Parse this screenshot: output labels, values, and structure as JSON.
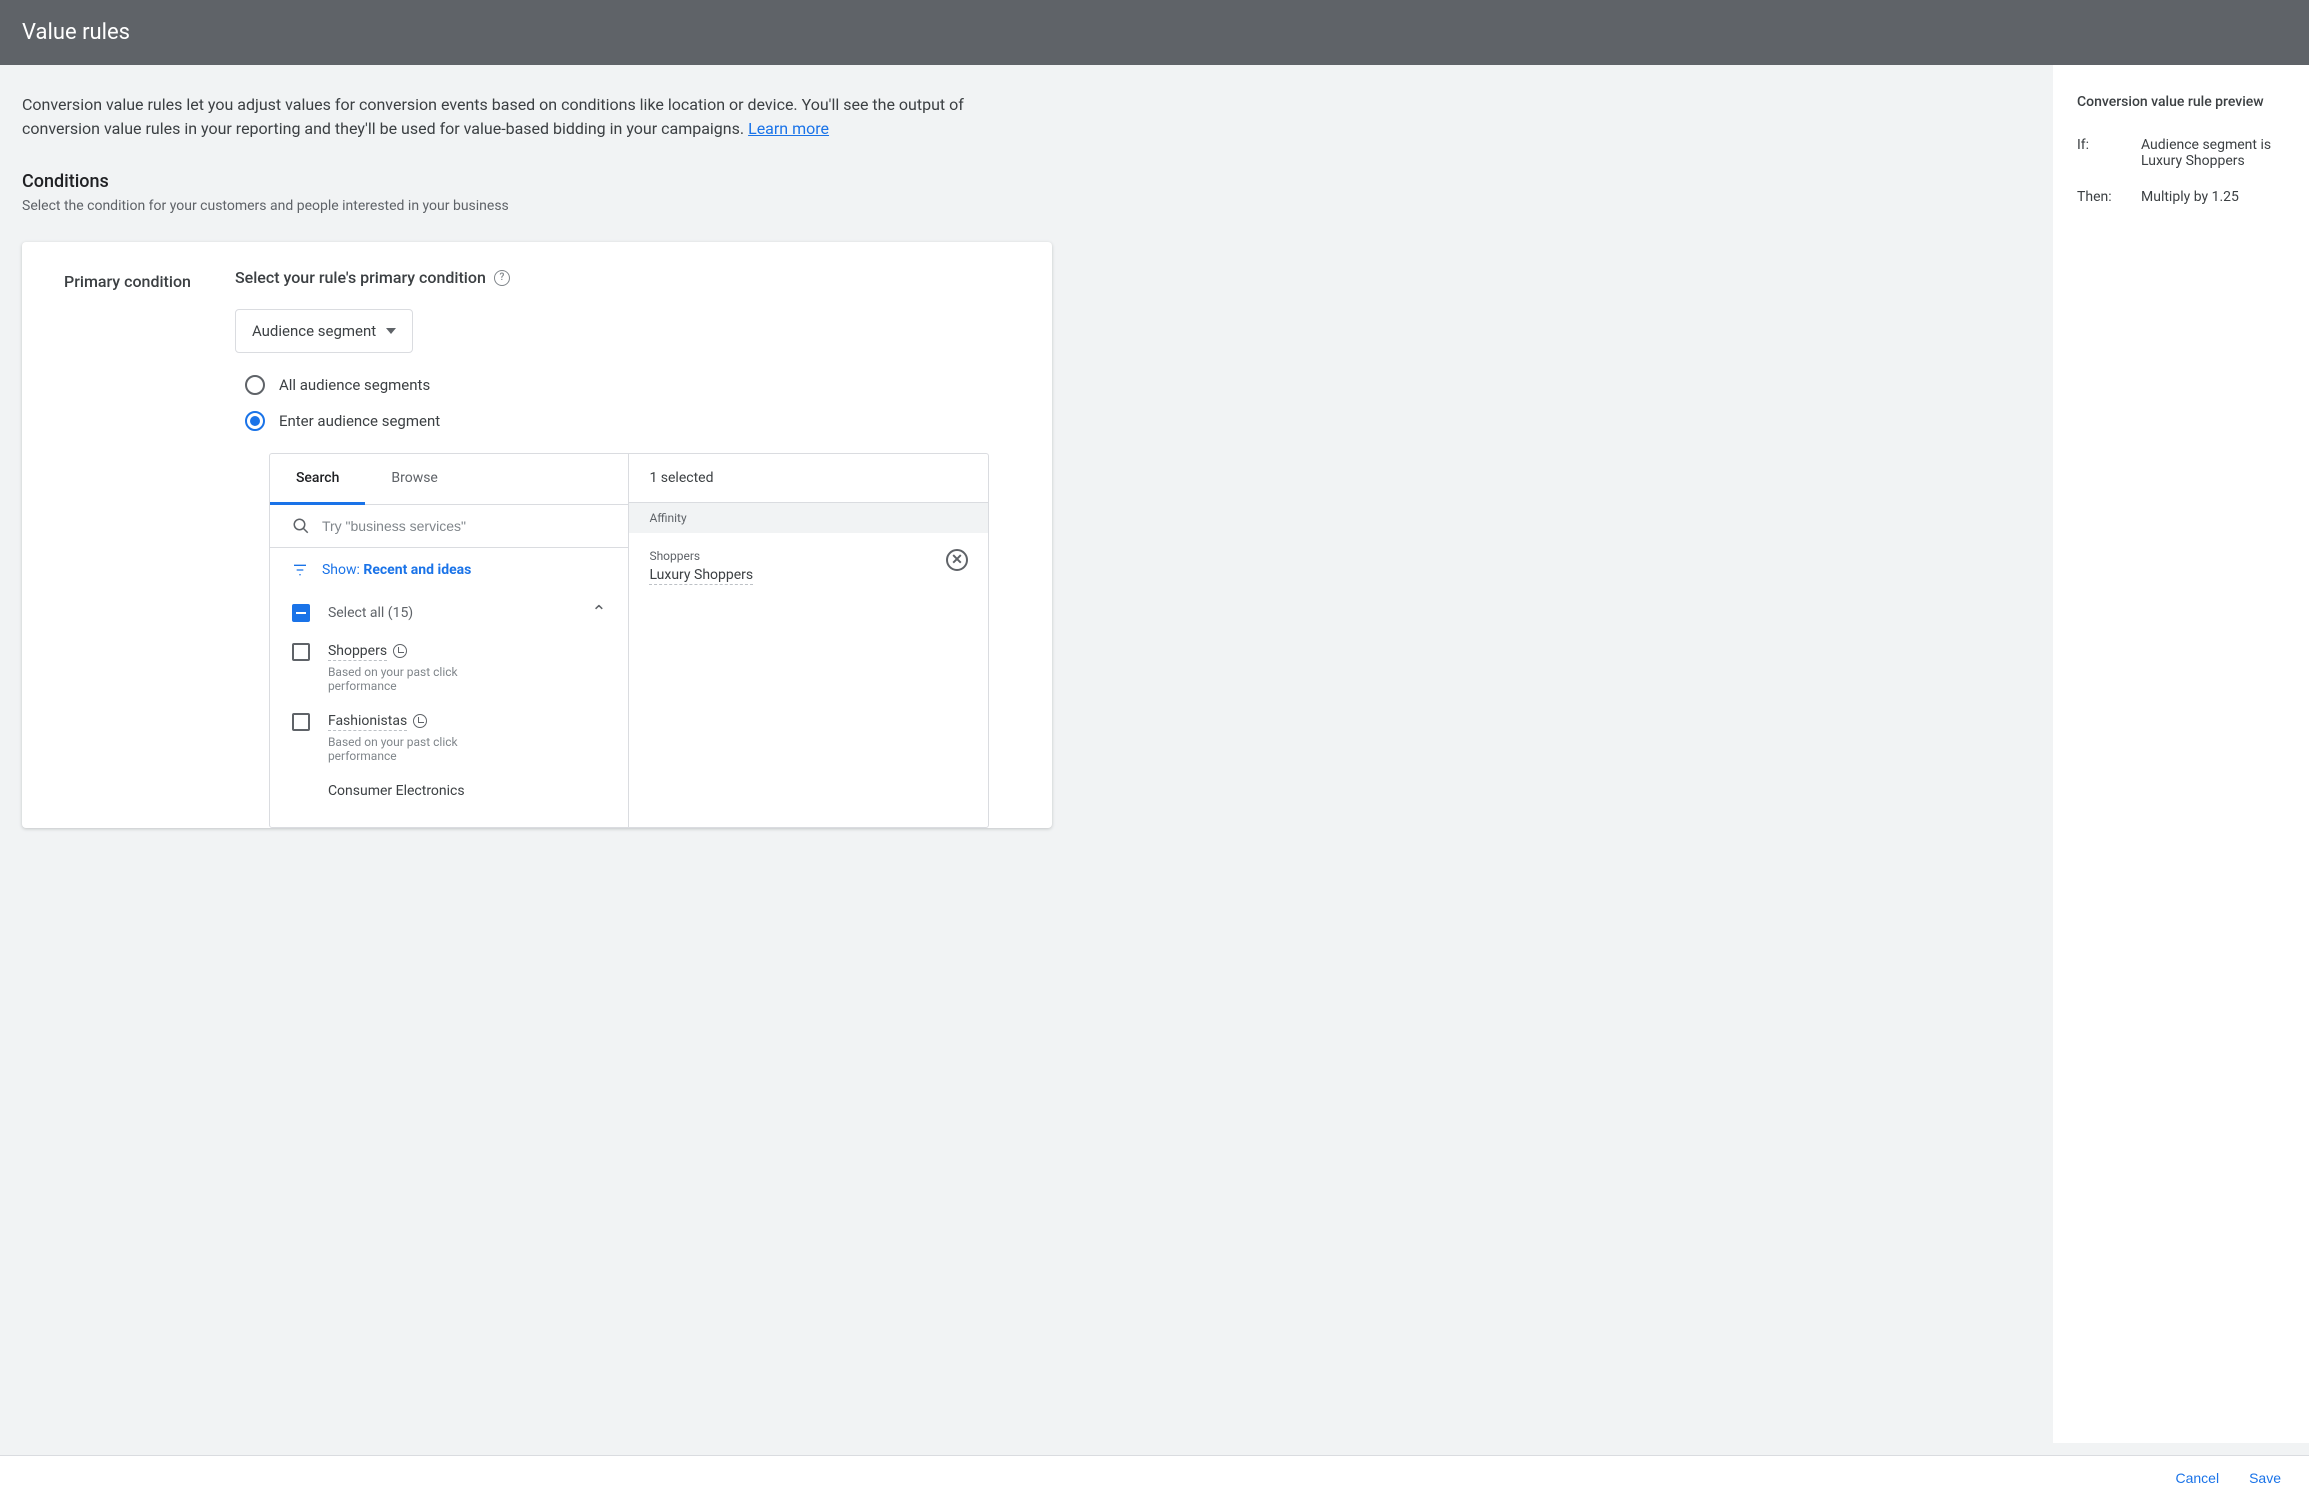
{
  "header": {
    "title": "Value rules"
  },
  "intro": {
    "text": "Conversion value rules let you adjust values for conversion events based on conditions like location or device. You'll see the output of conversion value rules in your reporting and they'll be used for value-based bidding in your campaigns. ",
    "link": "Learn more"
  },
  "conditions": {
    "heading": "Conditions",
    "sub": "Select the condition for your customers and people interested in your business"
  },
  "card": {
    "primary_label": "Primary condition",
    "rule_title": "Select your rule's primary condition",
    "dropdown_value": "Audience segment",
    "radio_all": "All audience segments",
    "radio_enter": "Enter audience segment"
  },
  "picker": {
    "tabs": {
      "search": "Search",
      "browse": "Browse"
    },
    "search_placeholder": "Try \"business services\"",
    "filter_prefix": "Show: ",
    "filter_value": "Recent and ideas",
    "select_all": "Select all (15)",
    "items": [
      {
        "name": "Shoppers",
        "desc": "Based on your past click performance",
        "clock": true
      },
      {
        "name": "Fashionistas",
        "desc": "Based on your past click performance",
        "clock": true
      },
      {
        "name": "Consumer Electronics",
        "desc": "",
        "clock": false
      }
    ],
    "selected_count": "1 selected",
    "affinity_label": "Affinity",
    "selected": {
      "category": "Shoppers",
      "name": "Luxury Shoppers"
    }
  },
  "sidebar": {
    "title": "Conversion value rule preview",
    "if_label": "If:",
    "if_value": "Audience segment is Luxury Shoppers",
    "then_label": "Then:",
    "then_value": "Multiply by 1.25"
  },
  "footer": {
    "cancel": "Cancel",
    "save": "Save"
  }
}
